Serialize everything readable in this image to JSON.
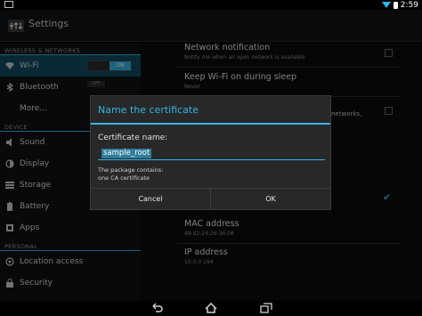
{
  "status_bar": {
    "time": "2:59"
  },
  "header": {
    "title": "Settings",
    "icon": "settings-icon"
  },
  "sidebar": {
    "sections": [
      {
        "header": "WIRELESS & NETWORKS",
        "items": [
          {
            "label": "Wi-Fi",
            "icon": "wifi-icon",
            "toggle": "ON",
            "active": true
          },
          {
            "label": "Bluetooth",
            "icon": "bluetooth-icon",
            "toggle": "OFF"
          },
          {
            "label": "More…"
          }
        ]
      },
      {
        "header": "DEVICE",
        "items": [
          {
            "label": "Sound",
            "icon": "sound-icon"
          },
          {
            "label": "Display",
            "icon": "display-icon"
          },
          {
            "label": "Storage",
            "icon": "storage-icon"
          },
          {
            "label": "Battery",
            "icon": "battery-icon"
          },
          {
            "label": "Apps",
            "icon": "apps-icon"
          }
        ]
      },
      {
        "header": "PERSONAL",
        "items": [
          {
            "label": "Location access",
            "icon": "location-icon"
          },
          {
            "label": "Security",
            "icon": "lock-icon"
          }
        ]
      }
    ]
  },
  "main": {
    "prefs": [
      {
        "title": "Network notification",
        "subtitle": "Notify me when an open network is available",
        "checked": false
      },
      {
        "title": "Keep Wi-Fi on during sleep",
        "subtitle": "Never"
      },
      {
        "title": "",
        "subtitle_fragment": "networks,",
        "checked": false
      },
      {
        "title": "",
        "checked": true
      },
      {
        "title": "MAC address",
        "subtitle": "48:d2:24:26:36:06"
      },
      {
        "title": "IP address",
        "subtitle": "10.0.0.194"
      }
    ]
  },
  "dialog": {
    "title": "Name the certificate",
    "field_label": "Certificate name:",
    "field_value": "sample_root",
    "note_line1": "The package contains:",
    "note_line2": "one CA certificate",
    "cancel_label": "Cancel",
    "ok_label": "OK"
  },
  "colors": {
    "accent": "#33b5e5",
    "active_item_bg": "#114c62",
    "dialog_bg": "#282828"
  }
}
